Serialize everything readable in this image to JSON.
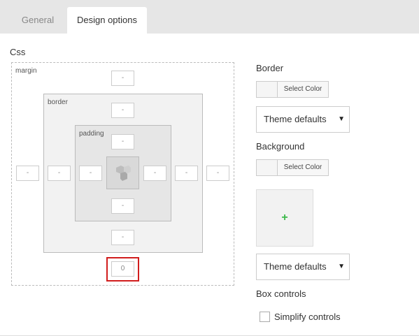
{
  "tabs": {
    "general": "General",
    "design": "Design options"
  },
  "css_panel": {
    "title": "Css",
    "margin_label": "margin",
    "border_label": "border",
    "padding_label": "padding",
    "margin": {
      "top": "-",
      "left": "-",
      "right": "-",
      "bottom": "0"
    },
    "border": {
      "top": "-",
      "left": "-",
      "right": "-",
      "bottom": "-"
    },
    "padding": {
      "top": "-",
      "left": "-",
      "right": "-",
      "bottom": "-"
    }
  },
  "right_panel": {
    "border_title": "Border",
    "border_color_button": "Select Color",
    "border_style_select": "Theme defaults",
    "background_title": "Background",
    "background_color_button": "Select Color",
    "background_image_add": "+",
    "background_style_select": "Theme defaults",
    "box_controls_title": "Box controls",
    "simplify_controls_label": "Simplify controls"
  },
  "colors": {
    "tab_bar": "#e6e6e6",
    "focus_border": "#d11d1d",
    "add_plus": "#3cb84a"
  },
  "icons": {
    "logo": "vc-logo-icon",
    "select_arrow": "chevron-down-icon",
    "add": "plus-icon"
  }
}
